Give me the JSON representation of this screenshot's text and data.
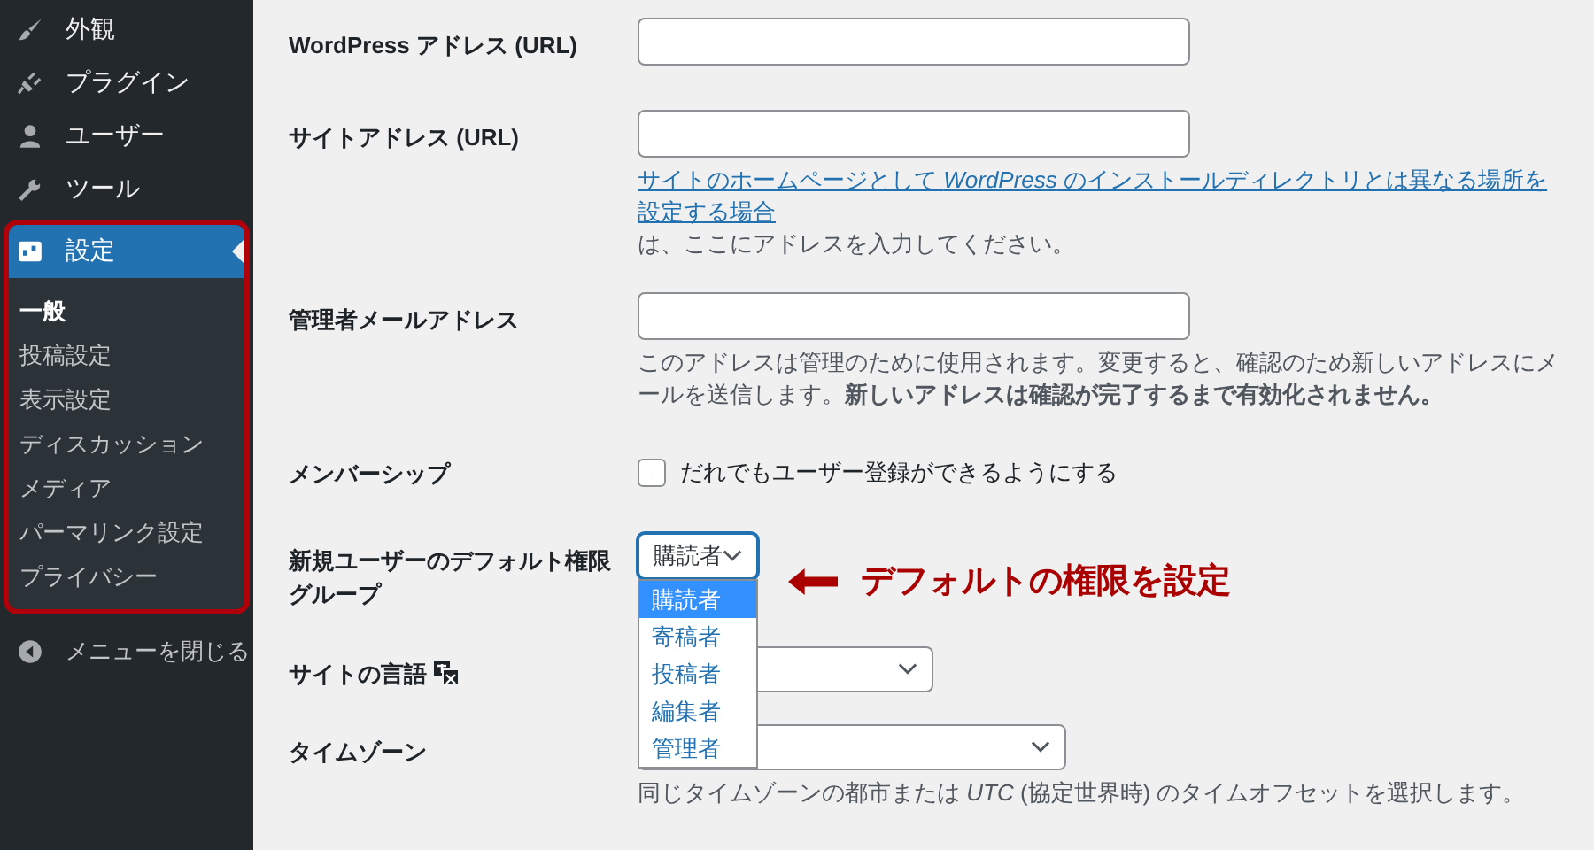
{
  "sidebar": {
    "items": [
      {
        "label": "外観",
        "selected": false
      },
      {
        "label": "プラグイン",
        "selected": false
      },
      {
        "label": "ユーザー",
        "selected": false
      },
      {
        "label": "ツール",
        "selected": false
      },
      {
        "label": "設定",
        "selected": true,
        "children": [
          {
            "label": "一般",
            "selected": true
          },
          {
            "label": "投稿設定",
            "selected": false
          },
          {
            "label": "表示設定",
            "selected": false
          },
          {
            "label": "ディスカッション",
            "selected": false
          },
          {
            "label": "メディア",
            "selected": false
          },
          {
            "label": "パーマリンク設定",
            "selected": false
          },
          {
            "label": "プライバシー",
            "selected": false
          }
        ]
      }
    ],
    "collapse": "メニューを閉じる"
  },
  "settings": [
    {
      "kind": "text",
      "label": "WordPress アドレス (URL)"
    },
    {
      "kind": "text",
      "label": "サイトアドレス (URL)",
      "description_link": "サイトのホームページとして *WordPress* のインストールディレクトリとは異なる場所を設定する場合",
      "description": "は、ここにアドレスを入力してください。"
    },
    {
      "kind": "text",
      "label": "管理者メールアドレス",
      "description": "このアドレスは管理のために使用されます。変更すると、確認のため新しいアドレスにメールを送信します。**新しいアドレスは確認が完了するまで有効化されません。**"
    },
    {
      "kind": "checkbox",
      "label": "メンバーシップ",
      "checkbox_label": "だれでもユーザー登録ができるようにする",
      "checked": false
    },
    {
      "kind": "dropdown",
      "label": "新規ユーザーのデフォルト権限グループ",
      "value": "購読者",
      "expanded": true,
      "options": [
        {
          "label": "購読者",
          "selected": true
        },
        {
          "label": "寄稿者",
          "selected": false
        },
        {
          "label": "投稿者",
          "selected": false
        },
        {
          "label": "編集者",
          "selected": false
        },
        {
          "label": "管理者",
          "selected": false
        }
      ]
    },
    {
      "kind": "select",
      "label": "サイトの言語",
      "label_icon": true
    },
    {
      "kind": "select",
      "label": "タイムゾーン",
      "description": "同じタイムゾーンの都市または *UTC* (協定世界時) のタイムオフセットを選択します。"
    }
  ],
  "annotation": "デフォルトの権限を設定"
}
